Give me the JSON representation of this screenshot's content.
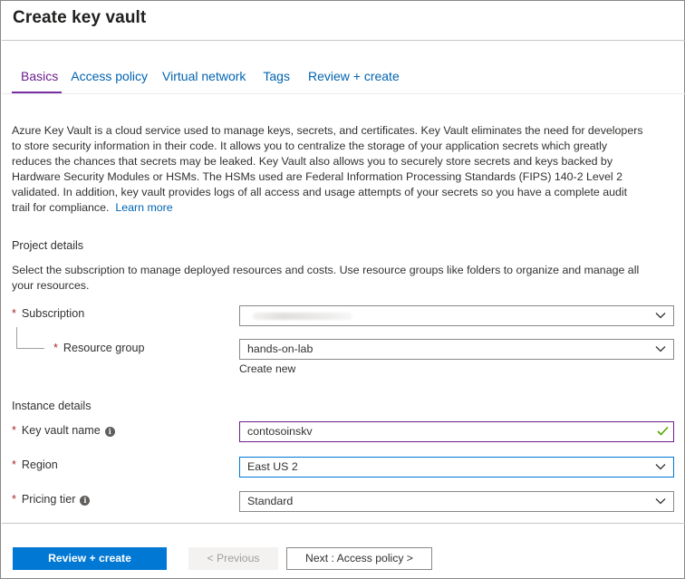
{
  "window": {
    "title": "Create key vault"
  },
  "tabs": [
    {
      "label": "Basics",
      "active": true
    },
    {
      "label": "Access policy",
      "active": false
    },
    {
      "label": "Virtual network",
      "active": false
    },
    {
      "label": "Tags",
      "active": false
    },
    {
      "label": "Review + create",
      "active": false
    }
  ],
  "description": {
    "lines": [
      "Azure Key Vault is a cloud service used to manage keys, secrets, and certificates. Key Vault eliminates the need for developers",
      "to store security information in their code. It allows you to centralize the storage of your application secrets which greatly",
      "reduces the chances that secrets may be leaked. Key Vault also allows you to securely store secrets and keys backed by",
      "Hardware Security Modules or HSMs. The HSMs used are Federal Information Processing Standards (FIPS) 140-2 Level 2",
      "validated. In addition, key vault provides logs of all access and usage attempts of your secrets so you have a complete audit",
      "trail for compliance."
    ],
    "learn_more": "Learn more"
  },
  "project_details": {
    "heading": "Project details",
    "lines": [
      "Select the subscription to manage deployed resources and costs. Use resource groups like folders to organize and manage all",
      "your resources."
    ],
    "subscription": {
      "label": "Subscription",
      "value": ""
    },
    "resource_group": {
      "label": "Resource group",
      "value": "hands-on-lab",
      "create_new": "Create new"
    }
  },
  "instance_details": {
    "heading": "Instance details",
    "key_vault_name": {
      "label": "Key vault name",
      "value": "contosoinskv"
    },
    "region": {
      "label": "Region",
      "value": "East US 2"
    },
    "pricing_tier": {
      "label": "Pricing tier",
      "value": "Standard"
    }
  },
  "required_marker": "*",
  "info_glyph": "i",
  "footer": {
    "review_create": "Review + create",
    "previous": "< Previous",
    "next": "Next : Access policy >"
  },
  "colors": {
    "accent": "#0078d4",
    "link": "#0063b1",
    "active_tab": "#7a2ea5",
    "required": "#a4262c",
    "valid_check": "#57a300"
  },
  "icons": {
    "info": "info-icon",
    "chevron": "chevron-down-icon",
    "valid": "checkmark-icon"
  }
}
